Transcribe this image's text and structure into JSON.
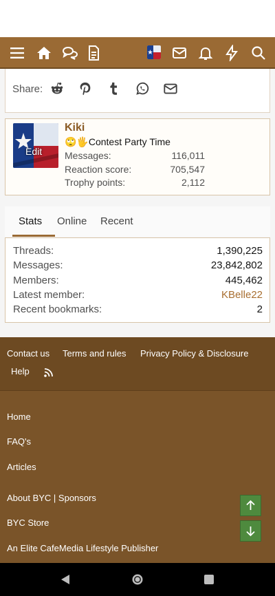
{
  "share": {
    "label": "Share:"
  },
  "member": {
    "name": "Kiki",
    "avatar_overlay": "Edit",
    "title": "🙄🖐Contest Party Time",
    "stats": [
      {
        "label": "Messages:",
        "value": "116,011"
      },
      {
        "label": "Reaction score:",
        "value": "705,547"
      },
      {
        "label": "Trophy points:",
        "value": "2,112"
      }
    ]
  },
  "tabs": [
    "Stats",
    "Online",
    "Recent"
  ],
  "forum_stats": [
    {
      "label": "Threads:",
      "value": "1,390,225"
    },
    {
      "label": "Messages:",
      "value": "23,842,802"
    },
    {
      "label": "Members:",
      "value": "445,462"
    },
    {
      "label": "Latest member:",
      "value": "KBelle22"
    },
    {
      "label": "Recent bookmarks:",
      "value": "2"
    }
  ],
  "footer": {
    "links_top": [
      "Contact us",
      "Terms and rules",
      "Privacy Policy & Disclosure",
      "Help"
    ],
    "links_bottom": [
      "Home",
      "FAQ's",
      "Articles",
      "About BYC | Sponsors",
      "BYC Store",
      "An Elite CafeMedia Lifestyle Publisher"
    ]
  },
  "colors": {
    "brand": "#9a6a34",
    "footer_dark": "#6d4a22",
    "footer": "#7a5429",
    "scroll_button": "#4e8a3e",
    "link": "#a86e30"
  },
  "icons": {
    "navbar": [
      "menu-icon",
      "home-icon",
      "forums-icon",
      "articles-icon",
      "inbox-icon",
      "alerts-icon",
      "whats-new-icon",
      "search-icon"
    ],
    "share": [
      "reddit-icon",
      "pinterest-icon",
      "tumblr-icon",
      "whatsapp-icon",
      "email-icon"
    ],
    "footer": [
      "rss-icon"
    ],
    "scroll": [
      "arrow-up-icon",
      "arrow-down-icon"
    ],
    "system": [
      "back-icon",
      "home-circle-icon",
      "recents-icon"
    ]
  }
}
